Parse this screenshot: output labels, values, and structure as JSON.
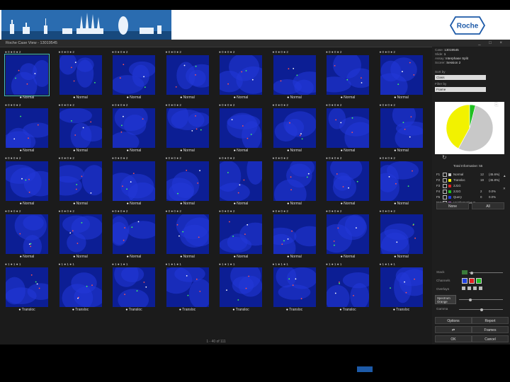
{
  "window": {
    "title": "Roche Case View - 13019545",
    "controls": "_ □ ×"
  },
  "cells": [
    {
      "cap": "Normal",
      "dots": "● 0 ● 0 ● 2",
      "sel": true
    },
    {
      "cap": "Normal",
      "dots": "● 0 ● 0 ● 2"
    },
    {
      "cap": "Normal",
      "dots": "● 0 ● 0 ● 2"
    },
    {
      "cap": "Normal",
      "dots": "● 0 ● 0 ● 2"
    },
    {
      "cap": "Normal",
      "dots": "● 0 ● 0 ● 2"
    },
    {
      "cap": "Normal",
      "dots": "● 0 ● 0 ● 2"
    },
    {
      "cap": "Normal",
      "dots": "● 0 ● 0 ● 2"
    },
    {
      "cap": "Normal",
      "dots": "● 0 ● 0 ● 2"
    },
    {
      "cap": "Normal",
      "dots": "● 0 ● 0 ● 2"
    },
    {
      "cap": "Normal",
      "dots": "● 0 ● 0 ● 2"
    },
    {
      "cap": "Normal",
      "dots": "● 0 ● 0 ● 2"
    },
    {
      "cap": "Normal",
      "dots": "● 0 ● 0 ● 2"
    },
    {
      "cap": "Normal",
      "dots": "● 0 ● 0 ● 2"
    },
    {
      "cap": "Normal",
      "dots": "● 0 ● 0 ● 2"
    },
    {
      "cap": "Normal",
      "dots": "● 0 ● 0 ● 2"
    },
    {
      "cap": "Normal",
      "dots": "● 0 ● 0 ● 2"
    },
    {
      "cap": "Normal",
      "dots": "● 0 ● 0 ● 2"
    },
    {
      "cap": "Normal",
      "dots": "● 0 ● 0 ● 2"
    },
    {
      "cap": "Normal",
      "dots": "● 0 ● 0 ● 2"
    },
    {
      "cap": "Normal",
      "dots": "● 0 ● 0 ● 2"
    },
    {
      "cap": "Normal",
      "dots": "● 0 ● 0 ● 2"
    },
    {
      "cap": "Normal",
      "dots": "● 0 ● 0 ● 2"
    },
    {
      "cap": "Normal",
      "dots": "● 0 ● 0 ● 2"
    },
    {
      "cap": "Normal",
      "dots": "● 0 ● 0 ● 2"
    },
    {
      "cap": "Normal",
      "dots": "● 0 ● 0 ● 2"
    },
    {
      "cap": "Normal",
      "dots": "● 0 ● 0 ● 2"
    },
    {
      "cap": "Normal",
      "dots": "● 0 ● 0 ● 2"
    },
    {
      "cap": "Normal",
      "dots": "● 0 ● 0 ● 2"
    },
    {
      "cap": "Normal",
      "dots": "● 0 ● 0 ● 2"
    },
    {
      "cap": "Normal",
      "dots": "● 0 ● 0 ● 2"
    },
    {
      "cap": "Normal",
      "dots": "● 0 ● 0 ● 2"
    },
    {
      "cap": "Normal",
      "dots": "● 0 ● 0 ● 2"
    },
    {
      "cap": "Transloc",
      "dots": "● 1 ● 1 ● 1"
    },
    {
      "cap": "Transloc",
      "dots": "● 1 ● 1 ● 1"
    },
    {
      "cap": "Transloc",
      "dots": "● 1 ● 1 ● 1"
    },
    {
      "cap": "Transloc",
      "dots": "● 1 ● 1 ● 1"
    },
    {
      "cap": "Transloc",
      "dots": "● 1 ● 1 ● 1"
    },
    {
      "cap": "Transloc",
      "dots": "● 1 ● 1 ● 1"
    },
    {
      "cap": "Transloc",
      "dots": "● 1 ● 1 ● 1"
    },
    {
      "cap": "Transloc",
      "dots": "● 1 ● 1 ● 1"
    }
  ],
  "pager": "1 - 40 of 111",
  "panel": {
    "case_label": "Case:",
    "case_value": "13019545",
    "slide_label": "Slide:",
    "slide_value": "1",
    "assay_label": "Assay:",
    "assay_value": "Interphase Split",
    "scorer_label": "Scorer:",
    "scorer_value": "Session 2",
    "sortby_label": "Sort by",
    "sortby_value": "Class",
    "filter_label": "Filter by",
    "filter_value": "Frame",
    "total_label": "Total Informative: 55",
    "classes": [
      {
        "key": "F1",
        "name": "Normal",
        "count": "12",
        "pct": "(45.6%)",
        "color": "#c8c8c8"
      },
      {
        "key": "F2",
        "name": "Transloc",
        "count": "18",
        "pct": "(45.8%)",
        "color": "#f2f200"
      },
      {
        "key": "F3",
        "name": "2J1G",
        "count": "",
        "pct": "",
        "color": "#e02020"
      },
      {
        "key": "F4",
        "name": "2J1G",
        "count": "2",
        "pct": "0.0%",
        "color": "#20c020"
      },
      {
        "key": "F5",
        "name": "Query",
        "count": "0",
        "pct": "0.0%",
        "color": "#2040e0"
      },
      {
        "key": "F10",
        "name": "Uninformative 8",
        "count": "",
        "pct": "",
        "color": "#a050c0"
      }
    ],
    "none_btn": "None",
    "all_btn": "All",
    "stack_label": "Stack",
    "channels_label": "Channels",
    "overlays_label": "Overlays",
    "spectrum_label": "Spectrum Orange",
    "gamma_label": "Gamma",
    "options_btn": "Options",
    "report_btn": "Report",
    "frames_btn": "Frames",
    "ok_btn": "OK",
    "cancel_btn": "Cancel"
  },
  "chart_data": {
    "type": "pie",
    "categories": [
      "Normal",
      "Transloc",
      "2J1G"
    ],
    "values": [
      54,
      42,
      4
    ],
    "colors": [
      "#c8c8c8",
      "#f2f200",
      "#20c020"
    ]
  },
  "brand": {
    "logo": "Roche"
  }
}
